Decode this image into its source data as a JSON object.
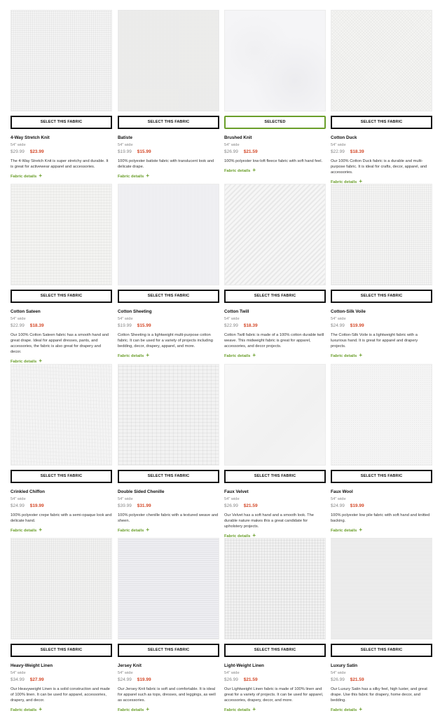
{
  "labels": {
    "select": "SELECT THIS FABRIC",
    "selected": "SELECTED",
    "details": "Fabric details",
    "details_plus": "+"
  },
  "colors": {
    "accent_green": "#6a9e2a",
    "sale_price": "#d44a2a",
    "muted_text": "#888888"
  },
  "fabrics": [
    {
      "name": "4-Way Stretch Knit",
      "width": "54\" wide",
      "price_old": "$29.99",
      "price_new": "$23.99",
      "selected": false,
      "texture": "knit",
      "desc": "The 4-Way Stretch Knit is super stretchy and durable. It is great for activewear apparel and accessories."
    },
    {
      "name": "Batiste",
      "width": "54\" wide",
      "price_old": "$19.99",
      "price_new": "$15.99",
      "selected": false,
      "texture": "batiste",
      "desc": "100% polyester batiste fabric with translucent look and delicate drape."
    },
    {
      "name": "Brushed Knit",
      "width": "54\" wide",
      "price_old": "$26.99",
      "price_new": "$21.59",
      "selected": true,
      "texture": "fleece",
      "desc": "100% polyester low-loft fleece fabric with soft hand feel."
    },
    {
      "name": "Cotton Duck",
      "width": "54\" wide",
      "price_old": "$22.99",
      "price_new": "$18.39",
      "selected": false,
      "texture": "duck",
      "desc": "Our 100% Cotton Duck fabric is a durable and multi-purpose fabric. It is ideal for crafts, decor, apparel, and accessories."
    },
    {
      "name": "Cotton Sateen",
      "width": "54\" wide",
      "price_old": "$22.99",
      "price_new": "$18.39",
      "selected": false,
      "texture": "sateen",
      "desc": "Our 100% Cotton Sateen fabric has a smooth hand and great drape. Ideal for apparel dresses, pants, and accessories, the fabric is also great for drapery and decor."
    },
    {
      "name": "Cotton Sheeting",
      "width": "54\" wide",
      "price_old": "$19.99",
      "price_new": "$15.99",
      "selected": false,
      "texture": "sheeting",
      "desc": "Cotton Sheeting is a lightweight multi-purpose cotton fabric. It can be used for a variety of projects including bedding, decor, drapery, apparel, and more."
    },
    {
      "name": "Cotton Twill",
      "width": "54\" wide",
      "price_old": "$22.99",
      "price_new": "$18.39",
      "selected": false,
      "texture": "twill",
      "desc": "Cotton Twill fabric is made of a 100% cotton durable twill weave. This midweight fabric is great for apparel, accessories, and decor projects."
    },
    {
      "name": "Cotton-Silk Voile",
      "width": "54\" wide",
      "price_old": "$24.99",
      "price_new": "$19.99",
      "selected": false,
      "texture": "voile",
      "desc": "The Cotton-Silk Voile is a lightweight fabric with a luxurious hand. It is great for apparel and drapery projects."
    },
    {
      "name": "Crinkled Chiffon",
      "width": "54\" wide",
      "price_old": "$24.99",
      "price_new": "$19.99",
      "selected": false,
      "texture": "crinkle",
      "desc": "100% polyester crepe fabric with a semi-opaque look and delicate hand."
    },
    {
      "name": "Double Sided Chenille",
      "width": "54\" wide",
      "price_old": "$39.99",
      "price_new": "$31.99",
      "selected": false,
      "texture": "chenille",
      "desc": "100% polyester chenille fabric with a textured weave and sheen."
    },
    {
      "name": "Faux Velvet",
      "width": "54\" wide",
      "price_old": "$26.99",
      "price_new": "$21.59",
      "selected": false,
      "texture": "velvet",
      "desc": "Our Velvet has a soft hand and a smooth look. The durable nature makes this a great candidate for upholstery projects."
    },
    {
      "name": "Faux Wool",
      "width": "54\" wide",
      "price_old": "$24.99",
      "price_new": "$19.99",
      "selected": false,
      "texture": "wool",
      "desc": "100% polyester low pile fabric with soft hand and knitted backing."
    },
    {
      "name": "Heavy-Weight Linen",
      "width": "54\" wide",
      "price_old": "$34.99",
      "price_new": "$27.99",
      "selected": false,
      "texture": "hlinen",
      "desc": "Our Heavyweight Linen is a solid construction and made of 100% linen. It can be used for apparel, accessories, drapery, and decor."
    },
    {
      "name": "Jersey Knit",
      "width": "54\" wide",
      "price_old": "$24.99",
      "price_new": "$19.99",
      "selected": false,
      "texture": "jersey",
      "desc": "Our Jersey Knit fabric is soft and comfortable. It is ideal for apparel such as tops, dresses, and leggings, as well as accessories."
    },
    {
      "name": "Light-Weight Linen",
      "width": "54\" wide",
      "price_old": "$26.99",
      "price_new": "$21.59",
      "selected": false,
      "texture": "llinen",
      "desc": "Our Lightweight Linen fabric is made of 100% linen and great for a variety of projects. It can be used for apparel, accessories, drapery, decor, and more."
    },
    {
      "name": "Luxury Satin",
      "width": "54\" wide",
      "price_old": "$26.99",
      "price_new": "$21.59",
      "selected": false,
      "texture": "satin",
      "desc": "Our Luxury Satin has a silky feel, high luster, and great drape. Use this fabric for drapery, home decor, and bedding."
    }
  ]
}
